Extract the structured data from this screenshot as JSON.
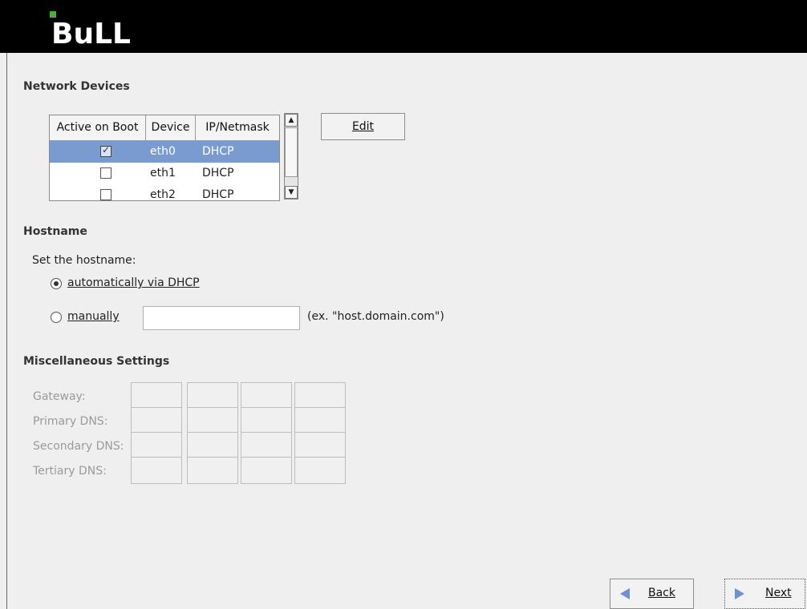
{
  "brand": {
    "logo_text": "BuLL",
    "accent": "#4caf2f"
  },
  "network": {
    "title": "Network Devices",
    "columns": [
      "Active on Boot",
      "Device",
      "IP/Netmask"
    ],
    "rows": [
      {
        "active": true,
        "device": "eth0",
        "ip": "DHCP",
        "selected": true
      },
      {
        "active": false,
        "device": "eth1",
        "ip": "DHCP",
        "selected": false
      },
      {
        "active": false,
        "device": "eth2",
        "ip": "DHCP",
        "selected": false
      }
    ],
    "edit_label": "Edit"
  },
  "hostname": {
    "title": "Hostname",
    "prompt": "Set the hostname:",
    "option_auto": "automatically via DHCP",
    "option_manual": "manually",
    "manual_value": "",
    "example": "(ex. \"host.domain.com\")"
  },
  "misc": {
    "title": "Miscellaneous Settings",
    "fields": [
      "Gateway:",
      "Primary DNS:",
      "Secondary DNS:",
      "Tertiary DNS:"
    ]
  },
  "nav": {
    "back_label": "Back",
    "next_label": "Next"
  },
  "colors": {
    "selection": "#7a9bd0",
    "arrow": "#6f8fcf"
  }
}
